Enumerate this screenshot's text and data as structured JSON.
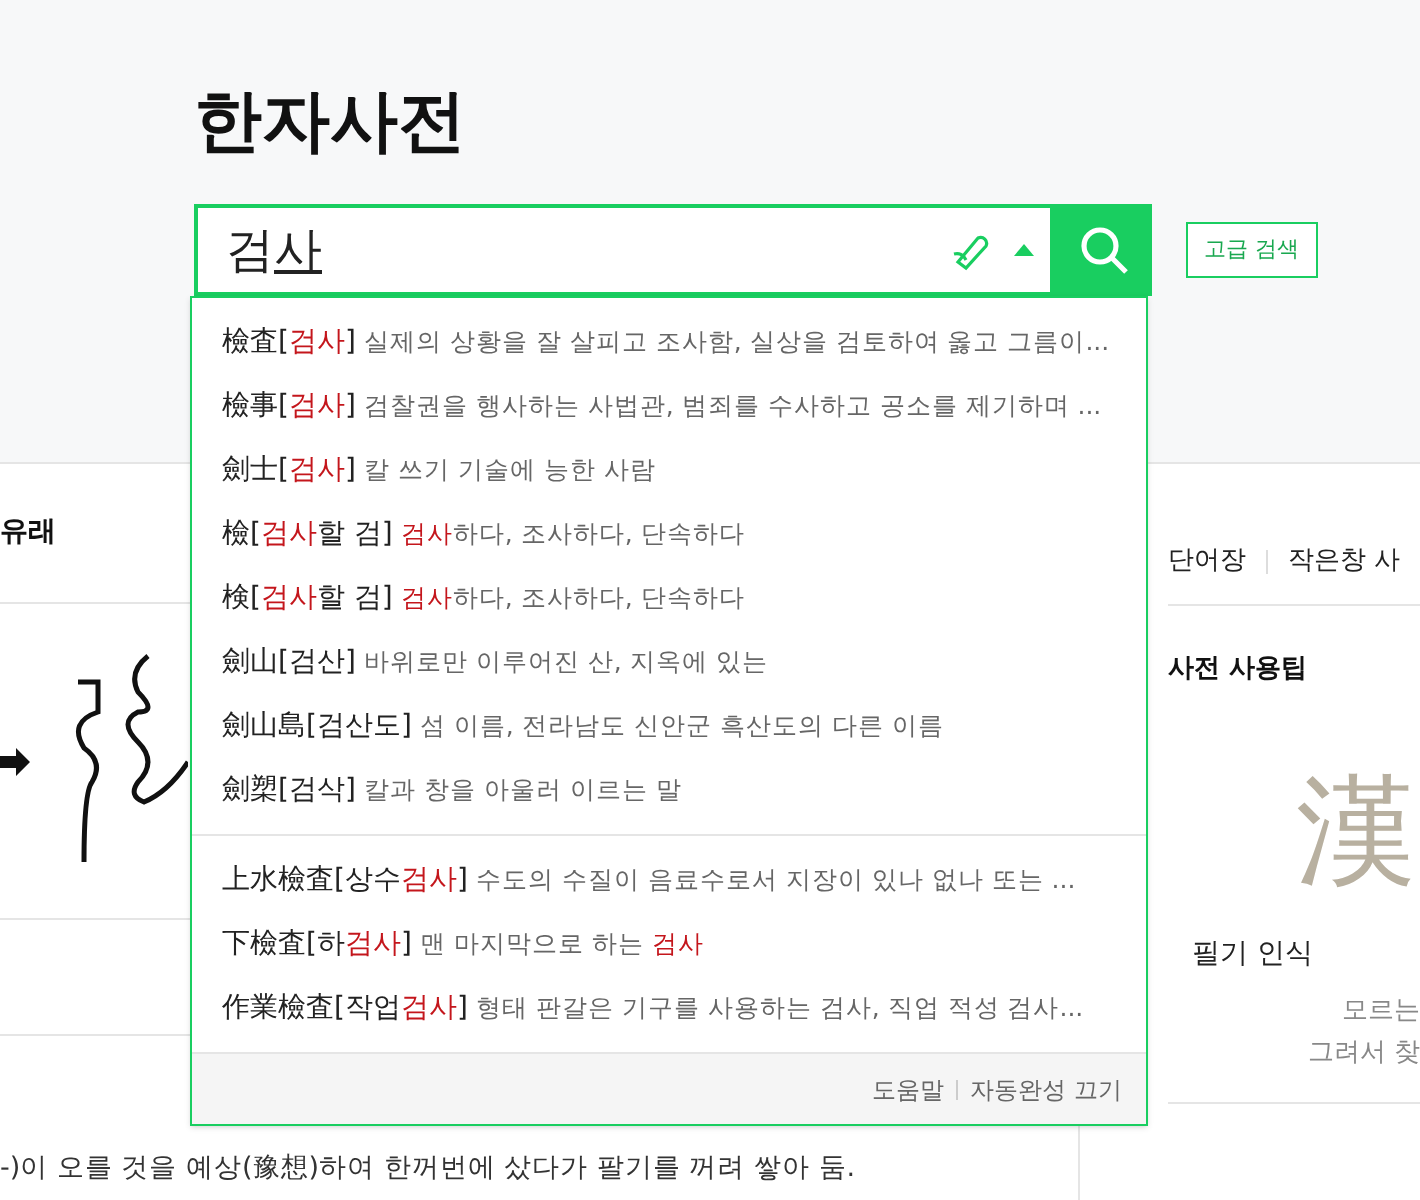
{
  "title": "한자사전",
  "search": {
    "value": "검사",
    "last_char_composing": true,
    "advanced_button": "고급 검색"
  },
  "suggestions": [
    [
      {
        "term": "檢査[**검사**]",
        "desc": "실제의 상황을 잘 살피고 조사함, 실상을 검토하여 옳고 그름이..."
      },
      {
        "term": "檢事[**검사**]",
        "desc": "검찰권을 행사하는 사법관, 범죄를 수사하고 공소를 제기하며 ..."
      },
      {
        "term": "劍士[**검사**]",
        "desc": "칼 쓰기 기술에 능한 사람"
      },
      {
        "term": "檢[**검사**할 검]",
        "desc": "**검사**하다, 조사하다, 단속하다"
      },
      {
        "term": "検[**검사**할 검]",
        "desc": "**검사**하다, 조사하다, 단속하다"
      },
      {
        "term": "劍山[검산]",
        "desc": "바위로만 이루어진 산, 지옥에 있는"
      },
      {
        "term": "劍山島[검산도]",
        "desc": "섬 이름, 전라남도 신안군 흑산도의 다른 이름"
      },
      {
        "term": "劍槊[검삭]",
        "desc": "칼과 창을 아울러 이르는 말"
      }
    ],
    [
      {
        "term": "上水檢査[상수**검사**]",
        "desc": "수도의 수질이 음료수로서 지장이 있나 없나 또는 ..."
      },
      {
        "term": "下檢査[하**검사**]",
        "desc": "맨 마지막으로 하는 **검사**"
      },
      {
        "term": "作業檢査[작업**검사**]",
        "desc": "형태 판갈은 기구를 사용하는 검사, 직업 적성 검사..."
      }
    ]
  ],
  "footer_links": [
    "도움말",
    "자동완성 끄기"
  ],
  "left_panel": {
    "heading": "유래",
    "sentence": "-)이 오를 것을 예상(豫想)하여 한꺼번에 샀다가 팔기를 꺼려 쌓아 둠."
  },
  "right_panel": {
    "tabs": [
      "단어장",
      "작은창 사"
    ],
    "tip_heading": "사전 사용팁",
    "tip_glyph": "漢",
    "tip_title": "필기 인식",
    "tip_lines": [
      "모르는",
      "그려서 찾"
    ]
  }
}
